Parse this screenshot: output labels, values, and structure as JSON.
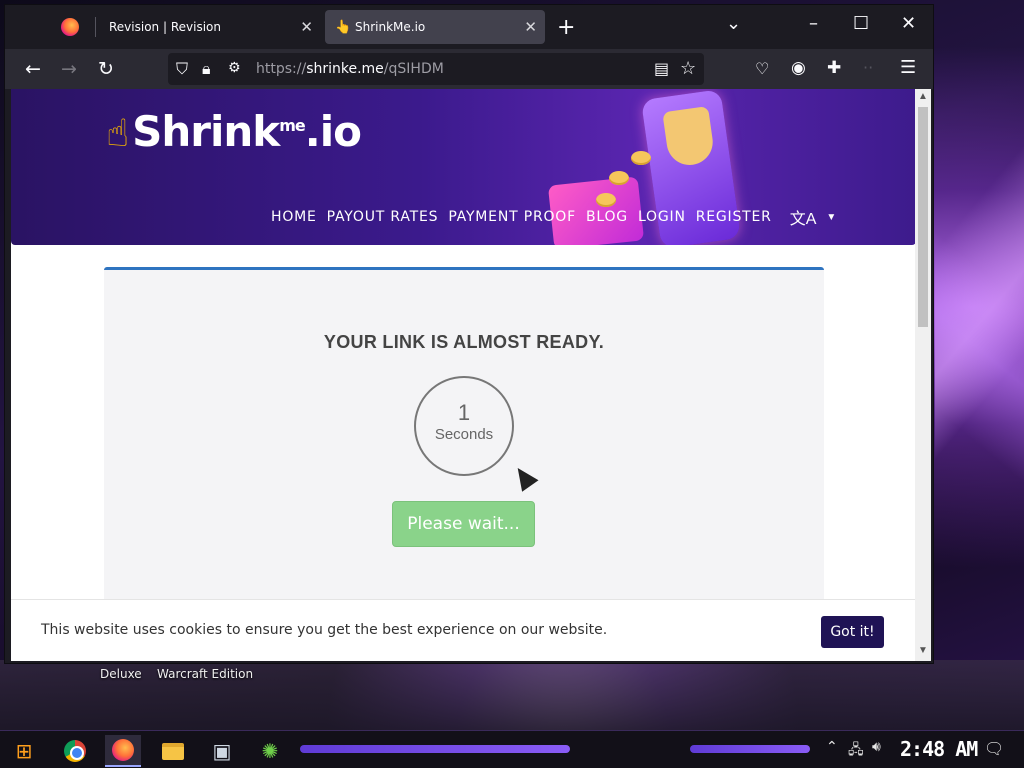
{
  "browser": {
    "tabs": [
      {
        "title": "Revision | Revision"
      },
      {
        "title": "ShrinkMe.io"
      }
    ],
    "new_tab_glyph": "+",
    "tab_list_glyph": "⌄",
    "window_controls": {
      "minimize": "–",
      "maximize": "☐",
      "close": "✕"
    },
    "url": {
      "scheme": "https://",
      "host": "shrinke.me",
      "path": "/qSIHDM"
    }
  },
  "site": {
    "logo": {
      "text": "Shrink",
      "me": "me",
      "suffix": ".io"
    },
    "nav": [
      "HOME",
      "PAYOUT RATES",
      "PAYMENT PROOF",
      "BLOG",
      "LOGIN",
      "REGISTER"
    ],
    "card": {
      "heading": "YOUR LINK IS ALMOST READY.",
      "countdown_value": "1",
      "countdown_unit": "Seconds",
      "button_label": "Please wait..."
    },
    "cookie": {
      "message": "This website uses cookies to ensure you get the best experience on our website.",
      "button_label": "Got it!"
    }
  },
  "desktop": {
    "labels": [
      "Deluxe",
      "Warcraft Edition"
    ]
  },
  "taskbar": {
    "clock": "2:48 AM",
    "apps": [
      "start-icon",
      "chrome-icon",
      "firefox-icon",
      "file-explorer-icon",
      "image-viewer-icon",
      "network-app-icon"
    ]
  },
  "colors": {
    "accent_blue": "#2f74c0",
    "wait_button_green": "#8ad38a",
    "cookie_button": "#1f1355",
    "hero_purple": "#3b1a8c"
  }
}
